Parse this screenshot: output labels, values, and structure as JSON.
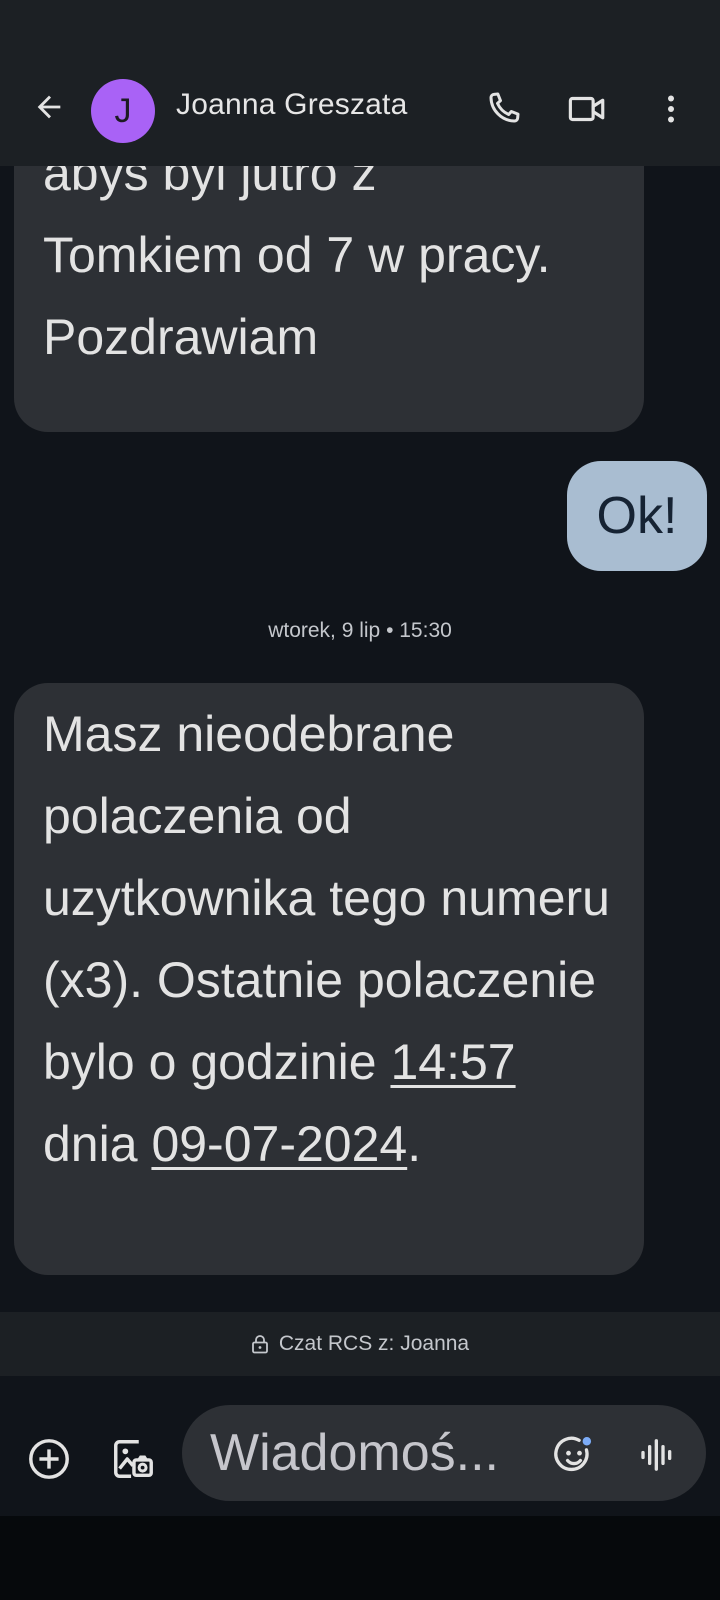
{
  "header": {
    "avatar_letter": "J",
    "contact_name": "Joanna Greszata",
    "avatar_color": "#a962f6",
    "icons": [
      "arrow-back-icon",
      "phone-icon",
      "video-call-icon",
      "more-vert-icon"
    ]
  },
  "conversation": {
    "previous_message": {
      "lines": [
        "abys byl jutro z",
        "Tomkiem od 7 w pracy.",
        "Pozdrawiam"
      ]
    },
    "outgoing_message": {
      "text": "Ok!"
    },
    "timestamp": "wtorek, 9 lip • 15:30",
    "latest_message": {
      "text_1": "Masz nieodebrane polaczenia od uzytkownika tego numeru (x3). Ostatnie polaczenie bylo o godzinie ",
      "time_link": "14:57",
      "text_2": " dnia ",
      "date_link": "09-07-2024",
      "text_3": "."
    }
  },
  "rcs_banner": {
    "text": "Czat RCS z: Joanna"
  },
  "composer": {
    "placeholder": "Wiadomoś...",
    "icons": [
      "add-circle-icon",
      "gallery-icon",
      "emoji-icon",
      "voice-message-icon"
    ]
  },
  "colors": {
    "background": "#10141a",
    "incoming_bubble": "#2d3035",
    "outgoing_bubble": "#a9bdd1"
  }
}
